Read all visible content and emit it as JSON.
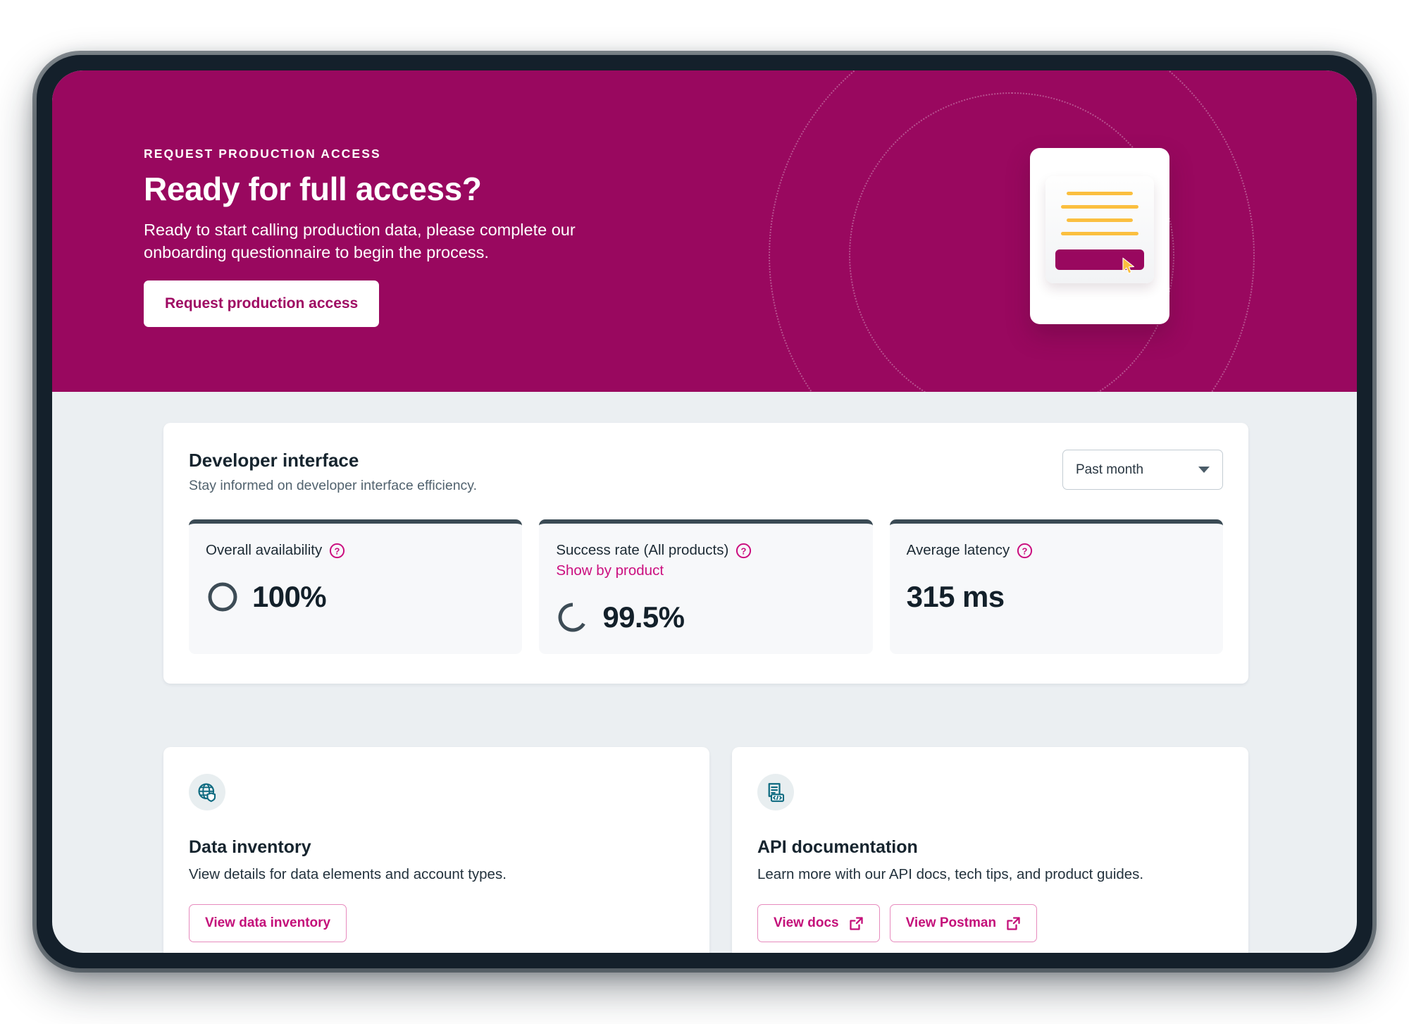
{
  "hero": {
    "eyebrow": "REQUEST PRODUCTION ACCESS",
    "title": "Ready for full access?",
    "subtitle": "Ready to start calling production data, please complete our onboarding questionnaire to begin the process.",
    "cta_label": "Request production access",
    "illustration": {
      "name": "questionnaire-document-illustration",
      "cursor": "arrow-cursor-icon",
      "line_color": "#fbbf3f",
      "button_color": "#99085f"
    },
    "background_color": "#99085f"
  },
  "developer_panel": {
    "title": "Developer interface",
    "subtitle": "Stay informed on developer interface efficiency.",
    "period_selector": {
      "selected": "Past month",
      "options": [
        "Past month"
      ]
    },
    "metrics": [
      {
        "label": "Overall availability",
        "help": "help-icon",
        "link": null,
        "value": "100%",
        "gauge": "full-ring",
        "gauge_percent": 100
      },
      {
        "label": "Success rate (All products)",
        "help": "help-icon",
        "link": "Show by product",
        "value": "99.5%",
        "gauge": "partial-ring",
        "gauge_percent": 99.5
      },
      {
        "label": "Average latency",
        "help": "help-icon",
        "link": null,
        "value": "315 ms",
        "gauge": null,
        "gauge_percent": null
      }
    ]
  },
  "info_cards": [
    {
      "icon": "globe-shield-icon",
      "title": "Data inventory",
      "description": "View details for data elements and account types.",
      "buttons": [
        {
          "label": "View data inventory",
          "icon": null
        }
      ]
    },
    {
      "icon": "api-code-document-icon",
      "title": "API documentation",
      "description": "Learn more with our API docs, tech tips, and product guides.",
      "buttons": [
        {
          "label": "View docs",
          "icon": "external-link-icon"
        },
        {
          "label": "View Postman",
          "icon": "external-link-icon"
        }
      ]
    }
  ],
  "colors": {
    "brand_magenta": "#99085f",
    "accent_pink": "#cb0f7f",
    "page_background": "#ebeff2",
    "card_background": "#f7f8fa",
    "metric_border": "#3a4a54",
    "teal_icon": "#0d6a80",
    "yellow": "#fbbf3f"
  }
}
